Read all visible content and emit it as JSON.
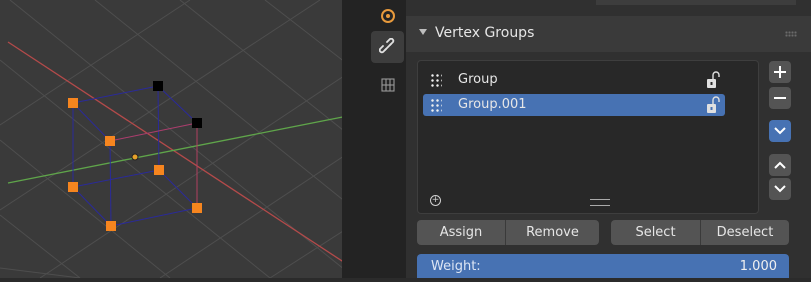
{
  "viewport": {
    "vertices_selected": 6,
    "vertices_unselected": 2
  },
  "properties_tabs": [
    {
      "icon": "object-properties-icon",
      "active": false
    },
    {
      "icon": "constraint-icon",
      "active": true
    },
    {
      "icon": "object-data-mesh-icon",
      "active": false
    }
  ],
  "panel": {
    "title": "Vertex Groups",
    "groups": [
      {
        "label": "Group",
        "selected": false,
        "locked": false
      },
      {
        "label": "Group.001",
        "selected": true,
        "locked": false
      }
    ],
    "side_buttons": [
      "plus-icon",
      "minus-icon",
      "chevron-down-icon",
      "triangle-up-icon",
      "triangle-down-icon"
    ],
    "actions_left": [
      "Assign",
      "Remove"
    ],
    "actions_right": [
      "Select",
      "Deselect"
    ],
    "weight": {
      "label": "Weight:",
      "value": "1.000"
    }
  },
  "colors": {
    "accent": "#4772b3",
    "selected_vertex": "#f6851f",
    "active_vertex": "#000000",
    "axis_x": "#b34a4a",
    "axis_y": "#5fa54a"
  }
}
